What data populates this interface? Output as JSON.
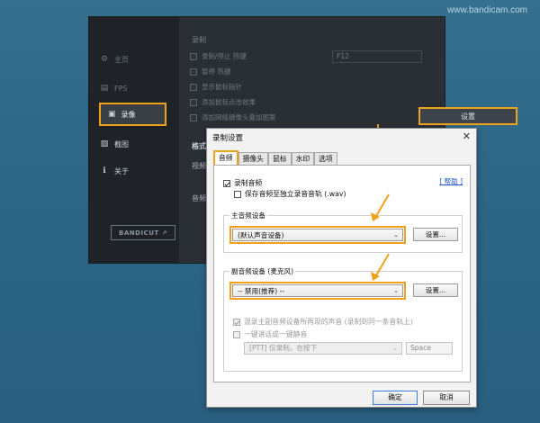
{
  "watermark": "www.bandicam.com",
  "app": {
    "sidebar": {
      "items": [
        {
          "label": "主页",
          "icon": "gear-icon"
        },
        {
          "label": "FPS",
          "icon": "fps-icon"
        },
        {
          "label": "录像",
          "icon": "video-icon"
        },
        {
          "label": "截图",
          "icon": "image-icon"
        },
        {
          "label": "关于",
          "icon": "info-icon"
        }
      ],
      "bandicut_label": "BANDICUT ↗"
    },
    "main": {
      "section_label": "录制",
      "options": [
        {
          "label": "录制/停止 热键",
          "checked": true
        },
        {
          "label": "暂停 热键",
          "checked": false
        },
        {
          "label": "显示鼠标指针",
          "checked": false
        },
        {
          "label": "添加鼠标点击效果",
          "checked": false
        },
        {
          "label": "添加网络摄像头叠加图案",
          "checked": false
        }
      ],
      "hotkey_value": "F12",
      "settings_button": "设置",
      "format_label": "格式",
      "video_label": "视频",
      "audio_label": "音频"
    }
  },
  "dialog": {
    "title": "录制设置",
    "tabs": [
      "音频",
      "摄像头",
      "鼠标",
      "水印",
      "选项"
    ],
    "active_tab": "音频",
    "help_link": "[ 帮助 ]",
    "record_audio": {
      "label": "录制音频",
      "checked": true
    },
    "save_separate": {
      "label": "保存音频至独立录音音轨 (.wav)",
      "checked": false
    },
    "primary_group": {
      "title": "主音频设备",
      "device": "(默认声音设备)",
      "settings_button": "设置..."
    },
    "secondary_group": {
      "title": "副音频设备 (麦克风)",
      "device": "-- 禁用(推荐) --",
      "settings_button": "设置...",
      "mix_option": {
        "label": "混录主副音频设备所再现的声音 (录制到同一条音轨上)",
        "checked": true
      },
      "ptt_option": {
        "label": "一键讲话或一键静音",
        "checked": false
      },
      "ptt_mode": "[PTT] 仅录制，在按下",
      "ptt_key": "Space"
    },
    "ok_button": "确定",
    "cancel_button": "取消"
  },
  "colors": {
    "highlight": "#f0a21a",
    "background": "#2f5f7c",
    "dialog": "#f2f2f2"
  }
}
